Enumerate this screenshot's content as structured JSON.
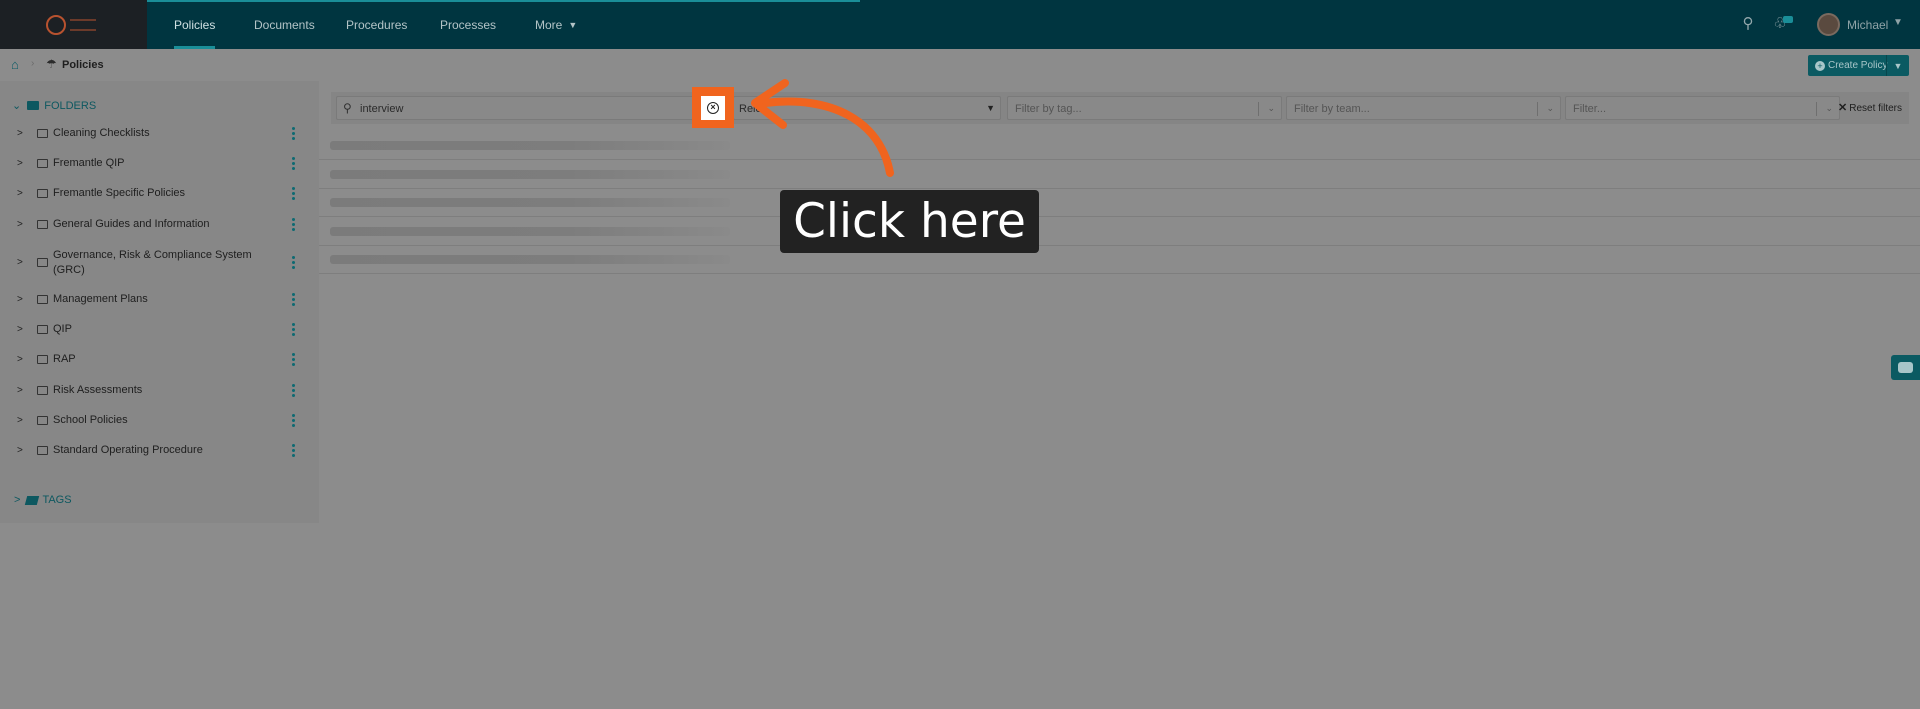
{
  "nav": {
    "items": [
      {
        "label": "Policies",
        "active": true
      },
      {
        "label": "Documents",
        "active": false
      },
      {
        "label": "Procedures",
        "active": false
      },
      {
        "label": "Processes",
        "active": false
      },
      {
        "label": "More",
        "active": false
      }
    ],
    "user_name": "Michael"
  },
  "breadcrumb": {
    "current": "Policies"
  },
  "actions": {
    "create_label": "Create Policy"
  },
  "sidebar": {
    "folders_label": "FOLDERS",
    "folders": [
      {
        "label": "Cleaning Checklists"
      },
      {
        "label": "Fremantle QIP"
      },
      {
        "label": "Fremantle Specific Policies"
      },
      {
        "label": "General Guides and Information"
      },
      {
        "label": "Governance, Risk & Compliance System (GRC)"
      },
      {
        "label": "Management Plans"
      },
      {
        "label": "QIP"
      },
      {
        "label": "RAP"
      },
      {
        "label": "Risk Assessments"
      },
      {
        "label": "School Policies"
      },
      {
        "label": "Standard Operating Procedure"
      }
    ],
    "tags_label": "TAGS"
  },
  "filters": {
    "search_value": "interview",
    "sort_value": "Rele",
    "tag_placeholder": "Filter by tag...",
    "team_placeholder": "Filter by team...",
    "generic_placeholder": "Filter...",
    "reset_label": "Reset filters"
  },
  "annotation": {
    "callout_text": "Click here",
    "accent_color": "#f0641e"
  },
  "colors": {
    "nav_bg": "#003540",
    "brand": "#0b5a62",
    "accent": "#1a8e98"
  },
  "icons": [
    "home-icon",
    "umbrella-icon",
    "search-icon",
    "bell-icon",
    "folder-icon",
    "tag-icon",
    "kebab-icon",
    "clear-icon",
    "robot-icon",
    "plus-circle-icon",
    "chevron-down-icon",
    "chevron-right-icon"
  ]
}
